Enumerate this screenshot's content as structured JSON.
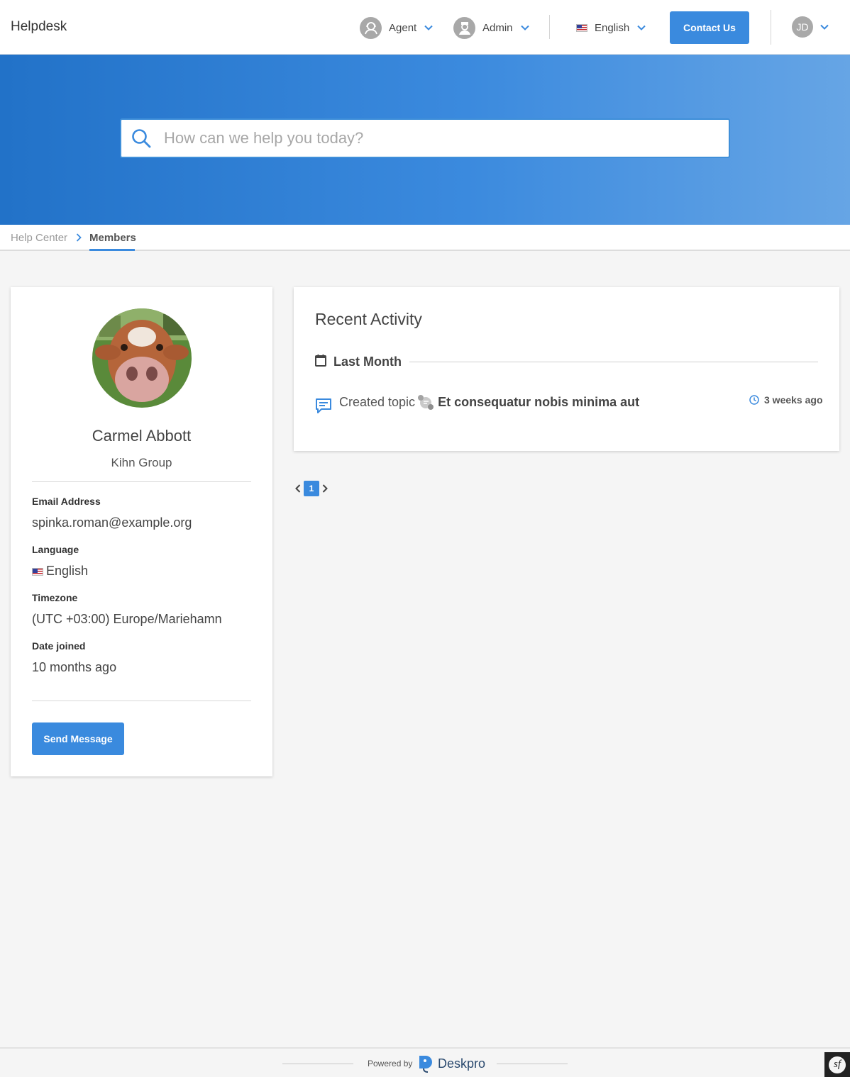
{
  "header": {
    "brand": "Helpdesk",
    "agent_label": "Agent",
    "admin_label": "Admin",
    "language_label": "English",
    "contact_label": "Contact Us",
    "user_initials": "JD"
  },
  "search": {
    "placeholder": "How can we help you today?"
  },
  "breadcrumb": {
    "home": "Help Center",
    "current": "Members"
  },
  "profile": {
    "name": "Carmel Abbott",
    "organization": "Kihn Group",
    "fields": [
      {
        "label": "Email Address",
        "value": "spinka.roman@example.org"
      },
      {
        "label": "Language",
        "value": "English"
      },
      {
        "label": "Timezone",
        "value": "(UTC +03:00) Europe/Mariehamn"
      },
      {
        "label": "Date joined",
        "value": "10 months ago"
      }
    ],
    "send_message_label": "Send Message"
  },
  "activity": {
    "title": "Recent Activity",
    "period": "Last Month",
    "items": [
      {
        "action": "Created topic",
        "topic": "Et consequatur nobis minima aut",
        "time": "3 weeks ago"
      }
    ]
  },
  "pagination": {
    "current_page": "1"
  },
  "footer": {
    "powered_by": "Powered by",
    "brand": "Deskpro",
    "framework_badge": "sf"
  },
  "colors": {
    "accent": "#3a8ade",
    "hero_start": "#2272c8",
    "hero_end": "#66a5e5"
  }
}
